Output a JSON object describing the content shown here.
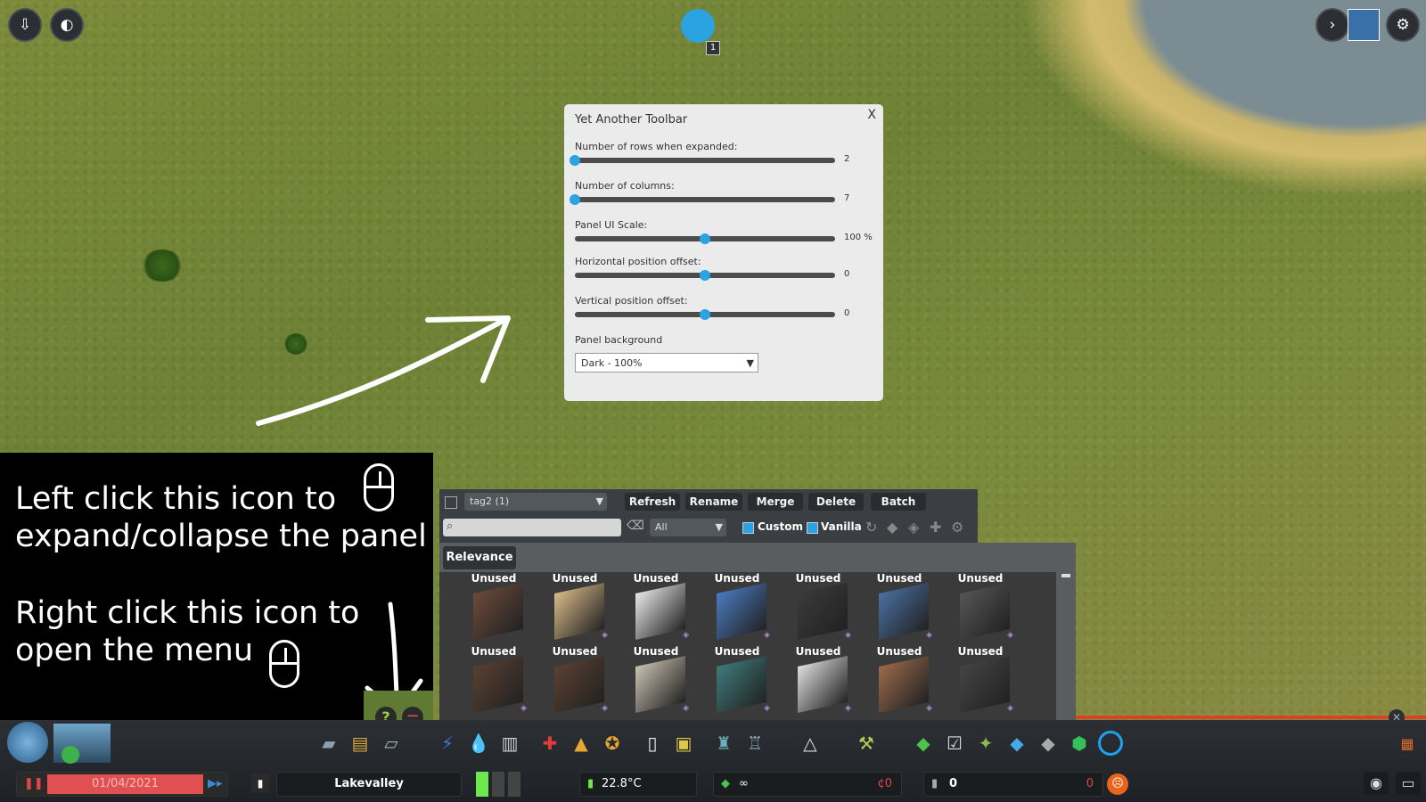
{
  "settings_panel": {
    "title": "Yet Another Toolbar",
    "close": "X",
    "rows_label": "Number of rows when expanded:",
    "rows_value": "2",
    "rows_fraction": 0.0,
    "columns_label": "Number of columns:",
    "columns_value": "7",
    "columns_fraction": 0.0,
    "scale_label": "Panel UI Scale:",
    "scale_value": "100 %",
    "scale_fraction": 0.5,
    "hoffset_label": "Horizontal position offset:",
    "hoffset_value": "0",
    "hoffset_fraction": 0.5,
    "voffset_label": "Vertical position offset:",
    "voffset_value": "0",
    "voffset_fraction": 0.5,
    "background_label": "Panel background",
    "background_value": "Dark - 100%"
  },
  "annotation": {
    "line1": "Left click this icon to",
    "line2": "expand/collapse the panel",
    "line3": "Right click this icon to",
    "line4": "open the menu"
  },
  "findit": {
    "tag_dropdown": "tag2 (1)",
    "buttons": [
      "Refresh",
      "Rename",
      "Merge",
      "Delete",
      "Batch"
    ],
    "search_placeholder": "",
    "filter_dropdown": "All",
    "custom_label": "Custom",
    "vanilla_label": "Vanilla",
    "sort_tab": "Relevance",
    "assets": [
      "Unused",
      "Unused",
      "Unused",
      "Unused",
      "Unused",
      "Unused",
      "Unused",
      "Unused",
      "Unused",
      "Unused",
      "Unused",
      "Unused",
      "Unused",
      "Unused"
    ]
  },
  "status_bar": {
    "date": "01/04/2021",
    "city_name": "Lakevalley",
    "temperature": "22.8°C",
    "money": "∞",
    "money_change": "¢0",
    "population": "0",
    "population_change": "0"
  },
  "colors": {
    "accent": "#29a3e2",
    "panel_bg": "#ebebeb",
    "toolbar_bg": "#3b3f43",
    "date_bg": "#e05050"
  }
}
